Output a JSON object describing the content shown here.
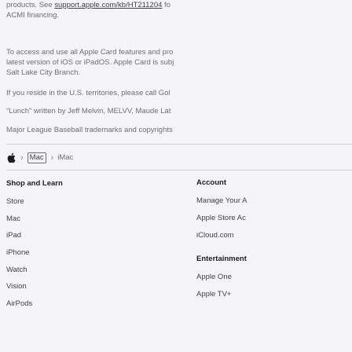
{
  "legal": {
    "p1_line1_prefix": "products. See ",
    "p1_link": "support.apple.com/kb/HT211204",
    "p1_line1_suffix": " fo",
    "p1_line2": "ACMI financing.",
    "p2_line1": "To access and use all Apple Card features and pro",
    "p2_line2": "latest version of iOS or iPadOS. Apple Card is subj",
    "p2_line3": "Salt Lake City Branch.",
    "p3": "If you reside in the U.S. territories, please call Gol",
    "p4": "“Lunch” written by Jeff Melvin, MELVV, Maude Lat",
    "p5": "Major League Baseball trademarks and copyrights"
  },
  "breadcrumb": {
    "home_icon": "apple-logo-icon",
    "mac_label": "Mac",
    "current": "iMac"
  },
  "footer": {
    "shop": {
      "heading": "Shop and Learn",
      "items": [
        "Store",
        "Mac",
        "iPad",
        "iPhone",
        "Watch",
        "Vision",
        "AirPods"
      ]
    },
    "account": {
      "heading": "Account",
      "items": [
        "Manage Your A",
        "Apple Store Ac",
        "iCloud.com"
      ]
    },
    "entertainment": {
      "heading": "Entertainment",
      "items": [
        "Apple One",
        "Apple TV+"
      ]
    }
  }
}
